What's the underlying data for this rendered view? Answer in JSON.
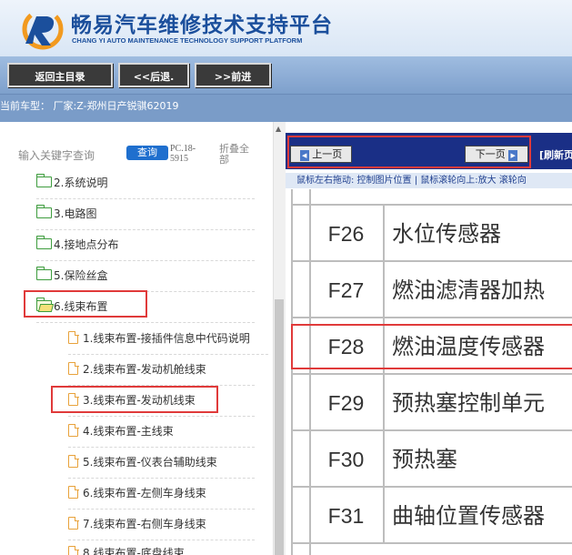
{
  "header": {
    "title": "畅易汽车维修技术支持平台",
    "subtitle": "CHANG YI AUTO MAINTENANCE TECHNOLOGY SUPPORT PLATFORM"
  },
  "toolbar": {
    "home_label": "返回主目录",
    "back_label": "<<后退.",
    "forward_label": ">>前进"
  },
  "model_bar": {
    "text": "当前车型： 厂家:Z-郑州日产锐骐62019"
  },
  "sidebar": {
    "search_label": "输入关键字查询",
    "query_button": "查询",
    "pc_text": "PC.18-5915",
    "collapse_label": "折叠全部",
    "items": [
      {
        "label": "2.系统说明",
        "type": "folder"
      },
      {
        "label": "3.电路图",
        "type": "folder"
      },
      {
        "label": "4.接地点分布",
        "type": "folder"
      },
      {
        "label": "5.保险丝盒",
        "type": "folder"
      },
      {
        "label": "6.线束布置",
        "type": "folder-open"
      },
      {
        "label": "1.线束布置-接插件信息中代码说明",
        "type": "doc"
      },
      {
        "label": "2.线束布置-发动机舱线束",
        "type": "doc"
      },
      {
        "label": "3.线束布置-发动机线束",
        "type": "doc"
      },
      {
        "label": "4.线束布置-主线束",
        "type": "doc"
      },
      {
        "label": "5.线束布置-仪表台辅助线束",
        "type": "doc"
      },
      {
        "label": "6.线束布置-左侧车身线束",
        "type": "doc"
      },
      {
        "label": "7.线束布置-右侧车身线束",
        "type": "doc"
      },
      {
        "label": "8.线束布置-底盘线束",
        "type": "doc"
      }
    ]
  },
  "content": {
    "prev_label": "上一页",
    "next_label": "下一页",
    "refresh_label": "[刷新页",
    "hint_text": "鼠标左右拖动: 控制图片位置 | 鼠标滚轮向上:放大  滚轮向",
    "rows": [
      {
        "code": "F26",
        "name": "水位传感器"
      },
      {
        "code": "F27",
        "name": "燃油滤清器加热"
      },
      {
        "code": "F28",
        "name": "燃油温度传感器"
      },
      {
        "code": "F29",
        "name": "预热塞控制单元"
      },
      {
        "code": "F30",
        "name": "预热塞"
      },
      {
        "code": "F31",
        "name": "曲轴位置传感器"
      }
    ]
  },
  "colors": {
    "brand_blue": "#1b4f9c",
    "highlight_red": "#e03a3a",
    "nav_dark_blue": "#1a2f86"
  }
}
